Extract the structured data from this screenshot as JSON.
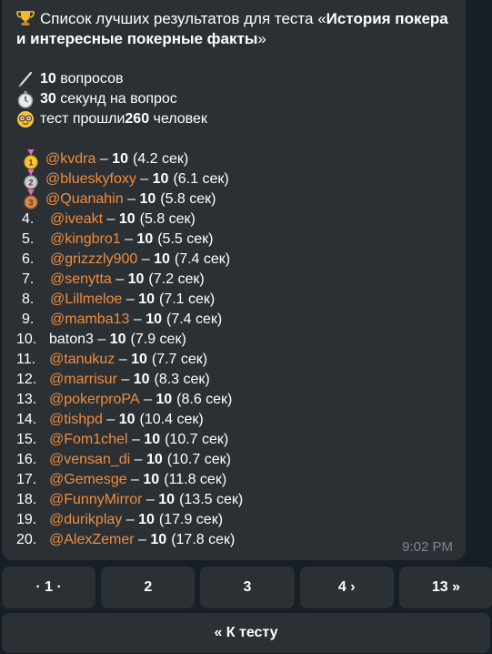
{
  "message": {
    "title_prefix": "Список лучших результатов для теста «",
    "title_bold": "История покера и интересные покерные факты",
    "title_suffix": "»",
    "stats": [
      {
        "icon": "pencil-icon",
        "bold": "10",
        "text": " вопросов",
        "prefix": ""
      },
      {
        "icon": "stopwatch-icon",
        "bold": "30",
        "text": " секунд на вопрос",
        "prefix": ""
      },
      {
        "icon": "nerd-face-icon",
        "bold": "260",
        "text": " человек",
        "prefix": "тест прошли "
      }
    ],
    "results": [
      {
        "rank": "",
        "medal": "gold",
        "user": "@kvdra",
        "score": "10",
        "time": "(4.2 сек)"
      },
      {
        "rank": "",
        "medal": "silver",
        "user": "@blueskyfoxy",
        "score": "10",
        "time": "(6.1 сек)"
      },
      {
        "rank": "",
        "medal": "bronze",
        "user": "@Quanahin",
        "score": "10",
        "time": "(5.8 сек)"
      },
      {
        "rank": "4.",
        "medal": "",
        "user": "@iveakt",
        "score": "10",
        "time": "(5.8 сек)"
      },
      {
        "rank": "5.",
        "medal": "",
        "user": "@kingbro1",
        "score": "10",
        "time": "(5.5 сек)"
      },
      {
        "rank": "6.",
        "medal": "",
        "user": "@grizzzly900",
        "score": "10",
        "time": "(7.4 сек)"
      },
      {
        "rank": "7.",
        "medal": "",
        "user": "@senytta",
        "score": "10",
        "time": "(7.2 сек)"
      },
      {
        "rank": "8.",
        "medal": "",
        "user": "@Lillmeloe",
        "score": "10",
        "time": "(7.1 сек)"
      },
      {
        "rank": "9.",
        "medal": "",
        "user": "@mamba13",
        "score": "10",
        "time": "(7.4 сек)"
      },
      {
        "rank": "10.",
        "medal": "",
        "user": "baton3",
        "score": "10",
        "time": "(7.9 сек)",
        "plain": true
      },
      {
        "rank": "11.",
        "medal": "",
        "user": "@tanukuz",
        "score": "10",
        "time": "(7.7 сек)"
      },
      {
        "rank": "12.",
        "medal": "",
        "user": "@marrisur",
        "score": "10",
        "time": "(8.3 сек)"
      },
      {
        "rank": "13.",
        "medal": "",
        "user": "@pokerproPA",
        "score": "10",
        "time": "(8.6 сек)"
      },
      {
        "rank": "14.",
        "medal": "",
        "user": "@tishpd",
        "score": "10",
        "time": "(10.4 сек)"
      },
      {
        "rank": "15.",
        "medal": "",
        "user": "@Fom1chel",
        "score": "10",
        "time": "(10.7 сек)"
      },
      {
        "rank": "16.",
        "medal": "",
        "user": "@vensan_di",
        "score": "10",
        "time": "(10.7 сек)"
      },
      {
        "rank": "17.",
        "medal": "",
        "user": "@Gemesge",
        "score": "10",
        "time": "(11.8 сек)"
      },
      {
        "rank": "18.",
        "medal": "",
        "user": "@FunnyMirror",
        "score": "10",
        "time": "(13.5 сек)"
      },
      {
        "rank": "19.",
        "medal": "",
        "user": "@durikplay",
        "score": "10",
        "time": "(17.9 сек)"
      },
      {
        "rank": "20.",
        "medal": "",
        "user": "@AlexZemer",
        "score": "10",
        "time": "(17.8 сек)"
      }
    ],
    "timestamp": "9:02 PM",
    "dash": " – "
  },
  "pager": {
    "buttons": [
      "· 1 ·",
      "2",
      "3",
      "4 ›",
      "13 »"
    ]
  },
  "back_button": "« К тесту",
  "colors": {
    "username": "#f08c3c",
    "bubble": "#2b3035",
    "background": "#181e25"
  }
}
